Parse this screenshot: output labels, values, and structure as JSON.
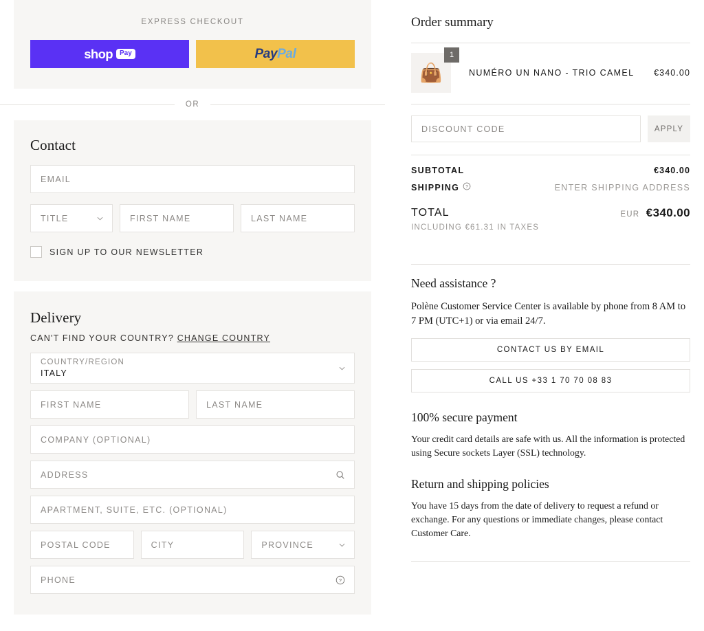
{
  "express": {
    "title": "EXPRESS CHECKOUT",
    "shop_pay": {
      "word": "shop",
      "badge": "Pay"
    },
    "paypal": {
      "pay": "Pay",
      "pal": "Pal"
    },
    "or": "OR"
  },
  "contact": {
    "title": "Contact",
    "email_placeholder": "EMAIL",
    "title_placeholder": "TITLE",
    "first_name_placeholder": "FIRST NAME",
    "last_name_placeholder": "LAST NAME",
    "newsletter_label": "SIGN UP TO OUR NEWSLETTER"
  },
  "delivery": {
    "title": "Delivery",
    "change_prompt": "CAN'T FIND YOUR COUNTRY?",
    "change_link": "CHANGE COUNTRY",
    "country_label": "COUNTRY/REGION",
    "country_value": "ITALY",
    "first_name_placeholder": "FIRST NAME",
    "last_name_placeholder": "LAST NAME",
    "company_placeholder": "COMPANY (OPTIONAL)",
    "address_placeholder": "ADDRESS",
    "apartment_placeholder": "APARTMENT, SUITE, ETC. (OPTIONAL)",
    "postal_placeholder": "POSTAL CODE",
    "city_placeholder": "CITY",
    "province_placeholder": "PROVINCE",
    "phone_placeholder": "PHONE"
  },
  "summary": {
    "title": "Order summary",
    "item": {
      "name": "NUMÉRO UN NANO - TRIO CAMEL",
      "price": "€340.00",
      "quantity": "1"
    },
    "discount_placeholder": "DISCOUNT CODE",
    "apply_label": "APPLY",
    "subtotal_label": "SUBTOTAL",
    "subtotal_value": "€340.00",
    "shipping_label": "SHIPPING",
    "shipping_value": "ENTER SHIPPING ADDRESS",
    "total_label": "TOTAL",
    "total_currency": "EUR",
    "total_value": "€340.00",
    "tax_note": "INCLUDING €61.31 IN TAXES"
  },
  "assistance": {
    "title": "Need assistance ?",
    "body": "Polène Customer Service Center is available by phone from 8 AM to 7 PM (UTC+1) or via email 24/7.",
    "email_button": "CONTACT US BY EMAIL",
    "call_button": "CALL US +33 1 70 70 08 83"
  },
  "secure": {
    "title": "100% secure payment",
    "body": "Your credit card details are safe with us. All the information is protected using Secure sockets Layer (SSL) technology."
  },
  "returns": {
    "title": "Return and shipping policies",
    "body": "You have 15 days from the date of delivery to request a refund or exchange. For any questions or immediate changes, please contact Customer Care."
  }
}
